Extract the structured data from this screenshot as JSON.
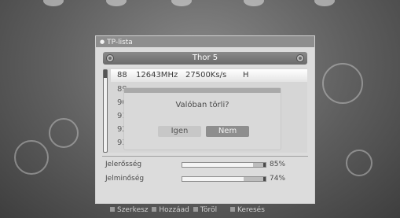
{
  "panel": {
    "title": "TP-lista"
  },
  "satellite": {
    "name": "Thor 5"
  },
  "transponders": [
    {
      "num": "88",
      "freq": "12643MHz",
      "sr": "27500Ks/s",
      "pol": "H",
      "selected": true
    },
    {
      "num": "89",
      "freq": "",
      "sr": "",
      "pol": ""
    },
    {
      "num": "90",
      "freq": "",
      "sr": "",
      "pol": ""
    },
    {
      "num": "91",
      "freq": "",
      "sr": "",
      "pol": ""
    },
    {
      "num": "92",
      "freq": "",
      "sr": "",
      "pol": ""
    },
    {
      "num": "93",
      "freq": "",
      "sr": "",
      "pol": ""
    }
  ],
  "dialog": {
    "message": "Valóban törli?",
    "yes": "Igen",
    "no": "Nem"
  },
  "signal": {
    "strength_label": "Jelerősség",
    "strength_pct": "85%",
    "strength_value": 0.85,
    "quality_label": "Jelminőség",
    "quality_pct": "74%",
    "quality_value": 0.74
  },
  "footer": {
    "edit": "Szerkesz",
    "add": "Hozzáad",
    "delete": "Töröl",
    "search": "Keresés"
  },
  "colors": {
    "accent_dark": "#8e8e8e",
    "selected_row": "#ffffff"
  }
}
